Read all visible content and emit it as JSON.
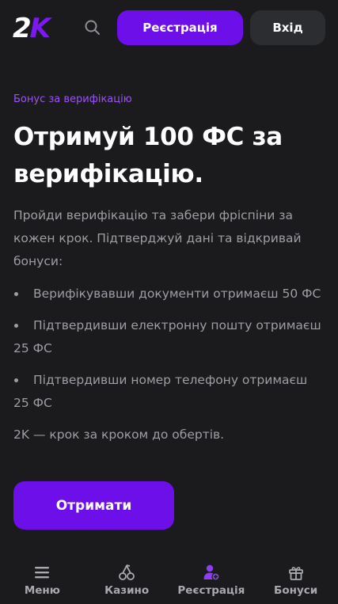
{
  "header": {
    "logo_text_a": "2",
    "logo_text_b": "K",
    "search_icon": "search-icon",
    "register_label": "Реєстрація",
    "login_label": "Вхід"
  },
  "promo": {
    "eyebrow": "Бонус за верифікацію",
    "title": "Отримуй 100 ФС за верифікацію.",
    "intro": "Пройди верифікацію та забери фріспіни за кожен крок. Підтверджуй дані та відкривай бонуси:",
    "bullets": [
      "Верифікувавши документи отримаєш 50 ФС",
      "Підтвердивши електронну пошту отримаєш 25 ФС",
      "Підтвердивши номер телефону отримаєш 25 ФС"
    ],
    "tagline": "2K — крок за кроком до обертів.",
    "cta_label": "Отримати"
  },
  "bottom_nav": {
    "items": [
      {
        "label": "Меню",
        "icon": "menu-icon"
      },
      {
        "label": "Казино",
        "icon": "cherries-icon"
      },
      {
        "label": "Реєстрація",
        "icon": "add-user-icon"
      },
      {
        "label": "Бонуси",
        "icon": "gift-icon"
      }
    ]
  },
  "colors": {
    "background": "#1b1b1e",
    "accent": "#6c0fe8",
    "accent_text": "#9c52f5",
    "muted_text": "#9d9ea4",
    "secondary_button": "#2c2d31"
  }
}
